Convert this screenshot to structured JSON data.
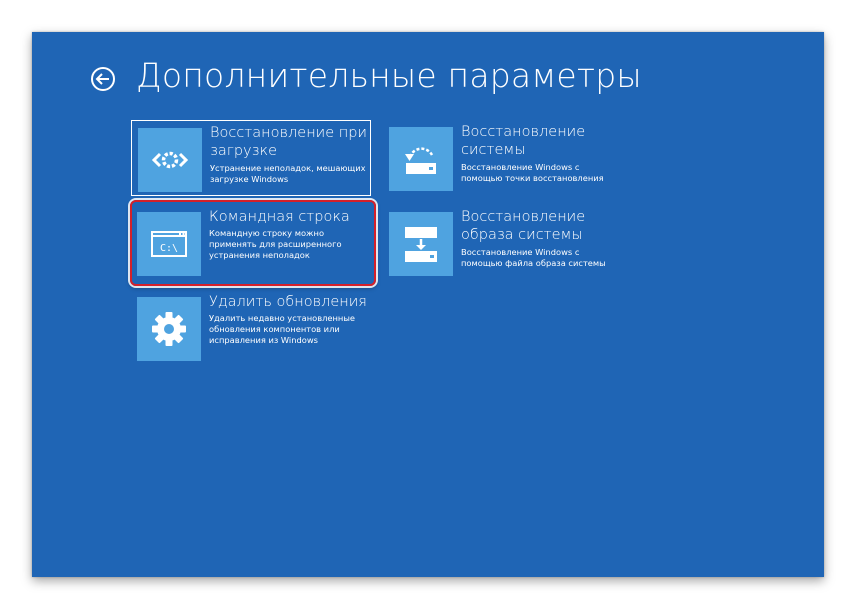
{
  "header": {
    "title": "Дополнительные параметры"
  },
  "tiles": [
    {
      "title": "Восстановление при загрузке",
      "description": "Устранение неполадок, мешающих загрузке Windows",
      "icon": "startup-repair-icon"
    },
    {
      "title": "Командная строка",
      "description": "Командную строку можно применять для расширенного устранения неполадок",
      "icon": "command-prompt-icon",
      "icon_text": "C:\\"
    },
    {
      "title": "Удалить обновления",
      "description": "Удалить недавно установленные обновления компонентов или исправления из Windows",
      "icon": "gear-icon"
    },
    {
      "title": "Восстановление системы",
      "description": "Восстановление Windows с помощью точки восстановления",
      "icon": "system-restore-icon"
    },
    {
      "title": "Восстановление образа системы",
      "description": "Восстановление Windows с помощью файла образа системы",
      "icon": "system-image-recovery-icon"
    }
  ],
  "colors": {
    "background": "#1f65b5",
    "tile_icon_bg": "#4fa3e0",
    "highlight": "#d4202a"
  }
}
